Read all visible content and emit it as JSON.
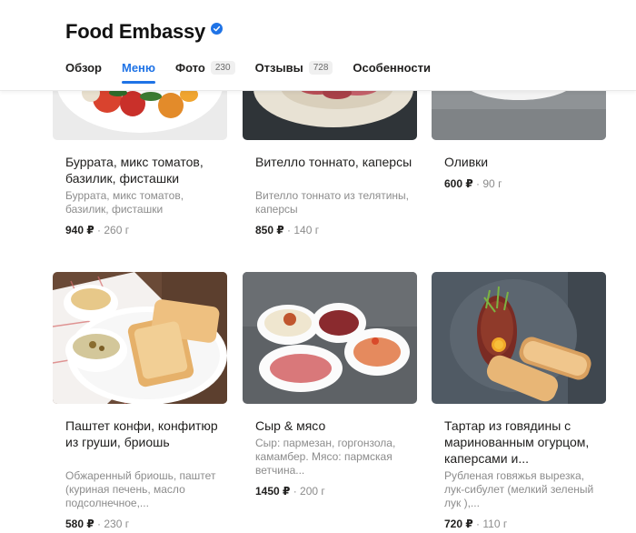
{
  "header": {
    "title": "Food Embassy",
    "tabs": [
      {
        "label": "Обзор",
        "count": ""
      },
      {
        "label": "Меню",
        "count": ""
      },
      {
        "label": "Фото",
        "count": "230"
      },
      {
        "label": "Отзывы",
        "count": "728"
      },
      {
        "label": "Особенности",
        "count": ""
      }
    ],
    "active_tab": "Меню",
    "accent_color": "#1f73e6"
  },
  "menu": {
    "row1": [
      {
        "name": "Буррата, микс томатов, базилик, фисташки",
        "description": "Буррата, микс томатов, базилик, фисташки",
        "price": "940 ₽",
        "weight": " · 260 г"
      },
      {
        "name": "Вителло тоннато, каперсы",
        "description": "Вителло тоннато из телятины, каперсы",
        "price": "850 ₽",
        "weight": " · 140 г"
      },
      {
        "name": "Оливки",
        "description": "",
        "price": "600 ₽",
        "weight": " · 90 г"
      }
    ],
    "row2": [
      {
        "name": "Паштет конфи, конфитюр из груши, бриошь",
        "description": "Обжаренный бриошь, паштет (куриная печень, масло подсолнечное,...",
        "price": "580 ₽",
        "weight": " · 230 г"
      },
      {
        "name": "Сыр & мясо",
        "description": "Сыр: пармезан, горгонзола, камамбер. Мясо: пармская ветчина...",
        "price": "1450 ₽",
        "weight": " · 200 г"
      },
      {
        "name": "Тартар из говядины с маринованным огурцом, каперсами и...",
        "description": "Рубленая говяжья вырезка, лук-сибулет (мелкий зеленый лук ),...",
        "price": "720 ₽",
        "weight": " · 110 г"
      }
    ]
  }
}
